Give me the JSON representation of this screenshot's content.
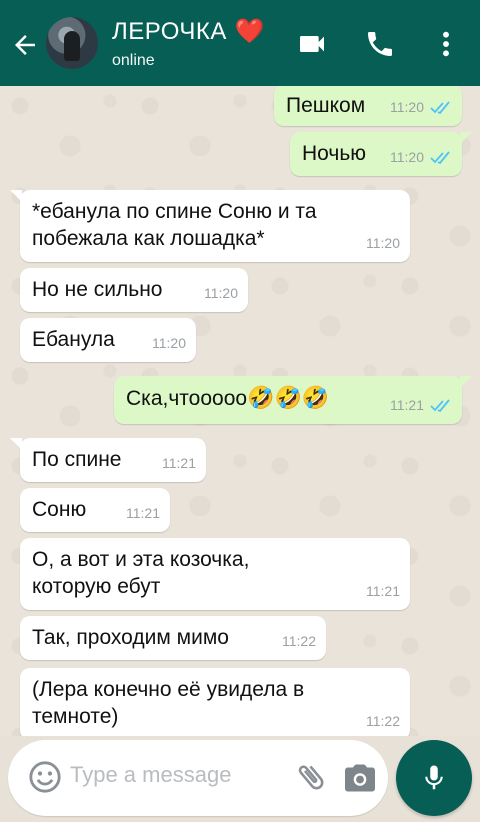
{
  "header": {
    "contact_name": "ЛЕРОЧКА",
    "heart": "❤️",
    "status": "online"
  },
  "messages": [
    {
      "dir": "out",
      "text": "Пешком",
      "time": "11:20"
    },
    {
      "dir": "out",
      "text": "Ночью",
      "time": "11:20"
    },
    {
      "dir": "in",
      "text": "*ебанула по спине Соню и та побежала как лошадка*",
      "time": "11:20"
    },
    {
      "dir": "in",
      "text": "Но не сильно",
      "time": "11:20"
    },
    {
      "dir": "in",
      "text": "Ебанула",
      "time": "11:20"
    },
    {
      "dir": "out",
      "text": "Ска,чтоoooo",
      "emoji": "🤣🤣🤣",
      "time": "11:21"
    },
    {
      "dir": "in",
      "text": "По спине",
      "time": "11:21"
    },
    {
      "dir": "in",
      "text": "Соню",
      "time": "11:21"
    },
    {
      "dir": "in",
      "text": "О, а вот и эта козочка, которую ебут",
      "time": "11:21"
    },
    {
      "dir": "in",
      "text": "Так, проходим мимо",
      "time": "11:22"
    },
    {
      "dir": "in",
      "text": "(Лера конечно её увидела в темноте)",
      "time": "11:22"
    }
  ],
  "composer": {
    "placeholder": "Type a message"
  },
  "icons": {
    "back": "back-arrow-icon",
    "video": "video-call-icon",
    "call": "phone-icon",
    "menu": "more-vert-icon",
    "smiley": "emoji-icon",
    "attach": "paperclip-icon",
    "camera": "camera-icon",
    "mic": "mic-icon",
    "ticks": "double-check-icon"
  },
  "colors": {
    "header": "#075e54",
    "incoming": "#ffffff",
    "outgoing": "#dcf8c6",
    "read_ticks": "#4fc3f7",
    "heart": "#e5393b"
  }
}
